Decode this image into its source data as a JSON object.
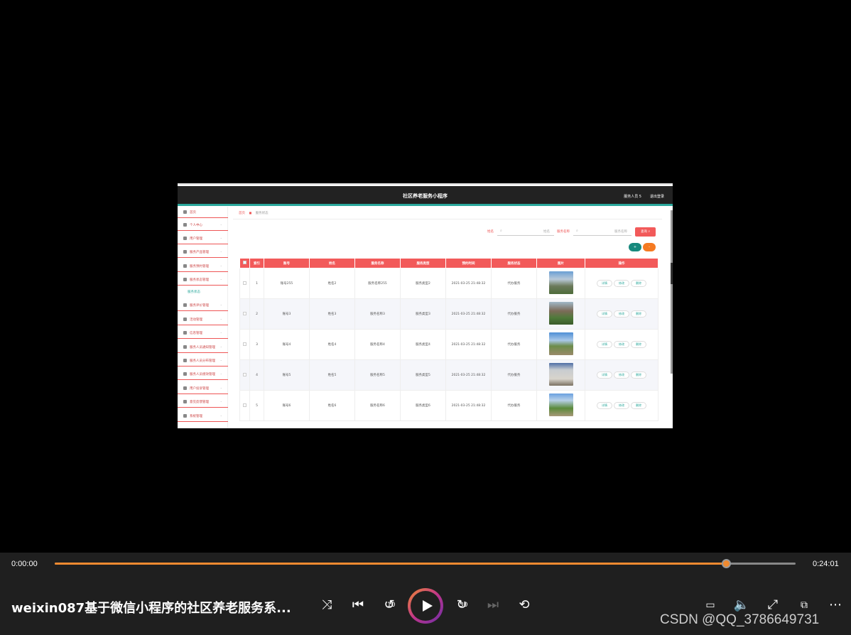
{
  "app": {
    "title": "社区养老服务小程序",
    "user": "服务人员 5",
    "logout": "退出登录"
  },
  "sidebar": {
    "items": [
      {
        "label": "首页"
      },
      {
        "label": "个人中心"
      },
      {
        "label": "用户管理"
      },
      {
        "label": "服务产品管理"
      },
      {
        "label": "服务预约管理"
      },
      {
        "label": "服务状态管理"
      },
      {
        "label": "服务评价管理"
      },
      {
        "label": "活动管理"
      },
      {
        "label": "信息管理"
      },
      {
        "label": "服务人员通知管理"
      },
      {
        "label": "服务人员分布管理"
      },
      {
        "label": "服务人员绩效管理"
      },
      {
        "label": "用户投诉管理"
      },
      {
        "label": "意见反馈管理"
      },
      {
        "label": "系统管理"
      }
    ],
    "active_sub": "服务状态"
  },
  "breadcrumb": {
    "home": "首页",
    "current": "服务状态"
  },
  "search": {
    "label1": "姓名",
    "placeholder1": "姓名",
    "label2": "服务名称",
    "placeholder2": "服务名称",
    "button": "查询"
  },
  "actions": {
    "add": "+",
    "delete": "-"
  },
  "table": {
    "headers": [
      "",
      "索引",
      "账号",
      "姓名",
      "服务名称",
      "服务类型",
      "预约时间",
      "服务状态",
      "图片",
      "操作"
    ],
    "rows": [
      {
        "idx": "1",
        "account": "账号255",
        "name": "姓名2",
        "service": "服务名称255",
        "type": "服务类型2",
        "time": "2021-03-25 21:48:32",
        "status": "代办服务"
      },
      {
        "idx": "2",
        "account": "账号3",
        "name": "姓名3",
        "service": "服务名称3",
        "type": "服务类型3",
        "time": "2021-03-25 21:48:32",
        "status": "代办服务"
      },
      {
        "idx": "3",
        "account": "账号4",
        "name": "姓名4",
        "service": "服务名称4",
        "type": "服务类型4",
        "time": "2021-03-25 21:48:32",
        "status": "代办服务"
      },
      {
        "idx": "4",
        "account": "账号5",
        "name": "姓名5",
        "service": "服务名称5",
        "type": "服务类型5",
        "time": "2021-03-25 21:48:32",
        "status": "代办服务"
      },
      {
        "idx": "5",
        "account": "账号6",
        "name": "姓名6",
        "service": "服务名称6",
        "type": "服务类型6",
        "time": "2021-03-25 21:48:32",
        "status": "代办服务"
      }
    ],
    "op_labels": [
      "详情",
      "修改",
      "删除"
    ]
  },
  "player": {
    "time_current": "0:00:00",
    "time_total": "0:24:01",
    "progress_fraction": 0.906,
    "title": "weixin087基于微信小程序的社区养老服务系...",
    "skip_back": "10",
    "skip_forward": "30",
    "watermark": "CSDN @QQ_3786649731"
  },
  "colors": {
    "accent": "#f25a5a",
    "teal": "#2aa89c",
    "progress": "#f08a30"
  }
}
